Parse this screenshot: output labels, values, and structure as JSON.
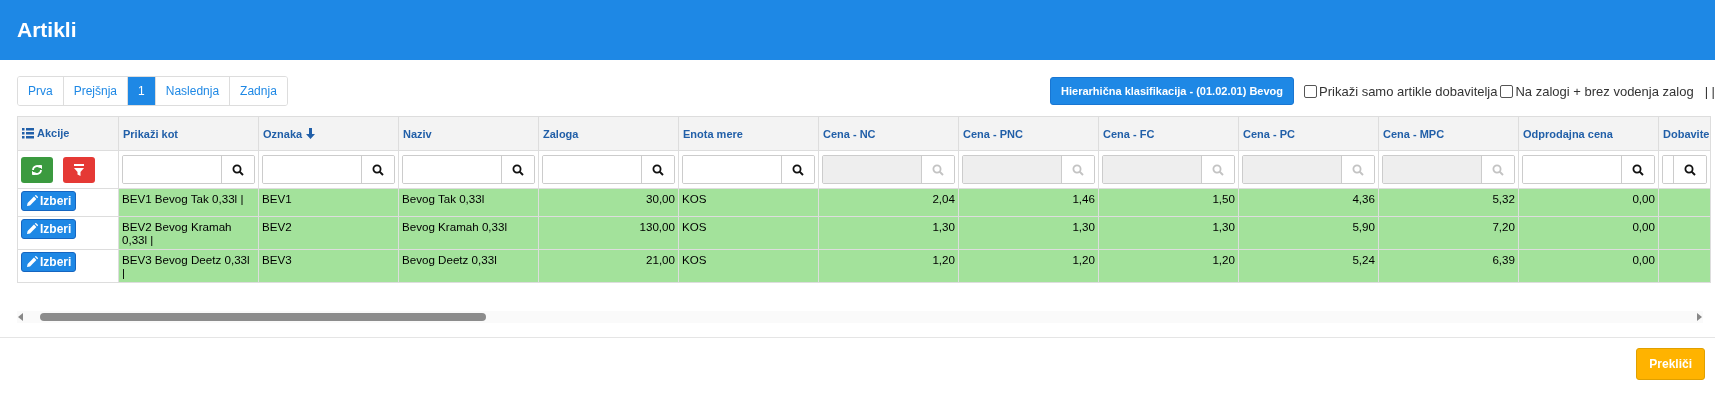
{
  "window": {
    "title": "Artikli"
  },
  "pagination": [
    {
      "label": "Prva",
      "selected": false
    },
    {
      "label": "Prejšnja",
      "selected": false
    },
    {
      "label": "1",
      "selected": true
    },
    {
      "label": "Naslednja",
      "selected": false
    },
    {
      "label": "Zadnja",
      "selected": false
    }
  ],
  "classification_button": "Hierarhična klasifikacija - (01.02.01) Bevog",
  "checkboxes": [
    {
      "label": "Prikaži samo artikle dobavitelja",
      "checked": false
    },
    {
      "label": "Na zalogi + brez vodenja zalog",
      "checked": false
    }
  ],
  "toolbar_separator": "| |",
  "table": {
    "columns": [
      {
        "label": "Akcije",
        "kind": "actions",
        "sorted": false
      },
      {
        "label": "Prikaži kot",
        "kind": "text",
        "sorted": false,
        "filter_disabled": false
      },
      {
        "label": "Oznaka",
        "kind": "text",
        "sorted": true,
        "filter_disabled": false
      },
      {
        "label": "Naziv",
        "kind": "text",
        "sorted": false,
        "filter_disabled": false
      },
      {
        "label": "Zaloga",
        "kind": "number",
        "sorted": false,
        "filter_disabled": false
      },
      {
        "label": "Enota mere",
        "kind": "text",
        "sorted": false,
        "filter_disabled": false
      },
      {
        "label": "Cena - NC",
        "kind": "number",
        "sorted": false,
        "filter_disabled": true
      },
      {
        "label": "Cena - PNC",
        "kind": "number",
        "sorted": false,
        "filter_disabled": true
      },
      {
        "label": "Cena - FC",
        "kind": "number",
        "sorted": false,
        "filter_disabled": true
      },
      {
        "label": "Cena - PC",
        "kind": "number",
        "sorted": false,
        "filter_disabled": true
      },
      {
        "label": "Cena - MPC",
        "kind": "number",
        "sorted": false,
        "filter_disabled": true
      },
      {
        "label": "Odprodajna cena",
        "kind": "number",
        "sorted": false,
        "filter_disabled": false
      },
      {
        "label": "Dobavite",
        "kind": "text",
        "filter_disabled": false
      }
    ],
    "rows": [
      {
        "cells": [
          "Izberi",
          "BEV1 Bevog Tak 0,33l |",
          "BEV1",
          "Bevog Tak 0,33l",
          "30,00",
          "KOS",
          "2,04",
          "1,46",
          "1,50",
          "4,36",
          "5,32",
          "0,00"
        ]
      },
      {
        "cells": [
          "Izberi",
          "BEV2 Bevog Kramah 0,33l |",
          "BEV2",
          "Bevog Kramah 0,33l",
          "130,00",
          "KOS",
          "1,30",
          "1,30",
          "1,30",
          "5,90",
          "7,20",
          "0,00"
        ]
      },
      {
        "cells": [
          "Izberi",
          "BEV3 Bevog Deetz 0,33l |",
          "BEV3",
          "Bevog Deetz 0,33l",
          "21,00",
          "KOS",
          "1,20",
          "1,20",
          "1,20",
          "5,24",
          "6,39",
          "0,00"
        ]
      }
    ]
  },
  "cancel_button": "Prekliči"
}
